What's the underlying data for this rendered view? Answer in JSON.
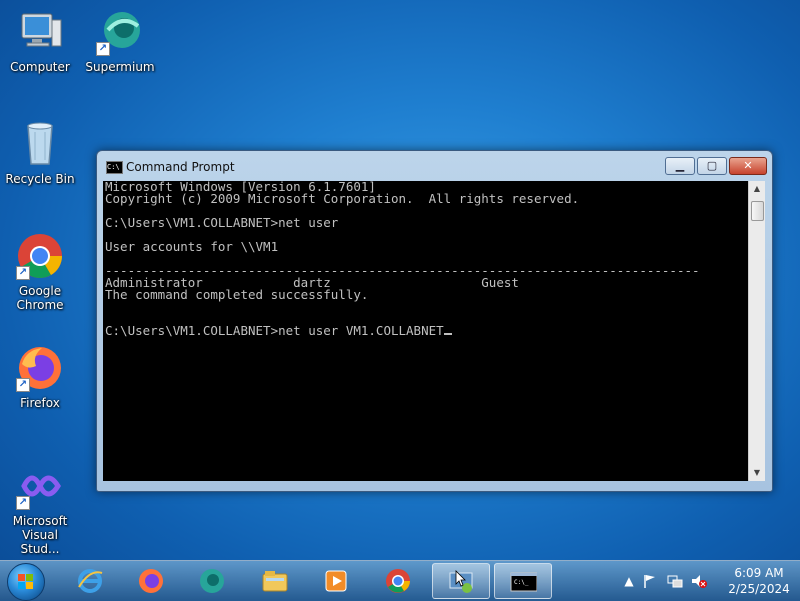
{
  "desktop": {
    "icons": [
      {
        "label": "Computer",
        "icon": "computer-icon"
      },
      {
        "label": "Supermium",
        "icon": "supermium-icon"
      },
      {
        "label": "Recycle Bin",
        "icon": "recycle-bin-icon"
      },
      {
        "label": "Google Chrome",
        "icon": "chrome-icon"
      },
      {
        "label": "Firefox",
        "icon": "firefox-icon"
      },
      {
        "label": "Microsoft Visual Stud...",
        "icon": "visual-studio-icon"
      }
    ]
  },
  "window": {
    "title": "Command Prompt",
    "icon": "cmd-icon",
    "buttons": {
      "minimize": "minimize-icon",
      "maximize": "maximize-icon",
      "close": "close-icon"
    }
  },
  "console": {
    "lines": [
      "Microsoft Windows [Version 6.1.7601]",
      "Copyright (c) 2009 Microsoft Corporation.  All rights reserved.",
      "",
      "C:\\Users\\VM1.COLLABNET>net user",
      "",
      "User accounts for \\\\VM1",
      "",
      "-------------------------------------------------------------------------------",
      "Administrator            dartz                    Guest",
      "The command completed successfully.",
      "",
      ""
    ],
    "prompt": "C:\\Users\\VM1.COLLABNET>",
    "input": "net user VM1.COLLABNET",
    "colors": {
      "background": "#000000",
      "text": "#c0c0c0"
    }
  },
  "taskbar": {
    "items": [
      {
        "name": "internet-explorer-icon"
      },
      {
        "name": "firefox-icon"
      },
      {
        "name": "supermium-icon"
      },
      {
        "name": "explorer-icon"
      },
      {
        "name": "media-player-icon"
      },
      {
        "name": "chrome-icon"
      },
      {
        "name": "remote-desktop-icon"
      },
      {
        "name": "cmd-icon",
        "active": true
      }
    ],
    "tray": {
      "show_hidden": "▲",
      "clock_time": "6:09 AM",
      "clock_date": "2/25/2024"
    }
  }
}
